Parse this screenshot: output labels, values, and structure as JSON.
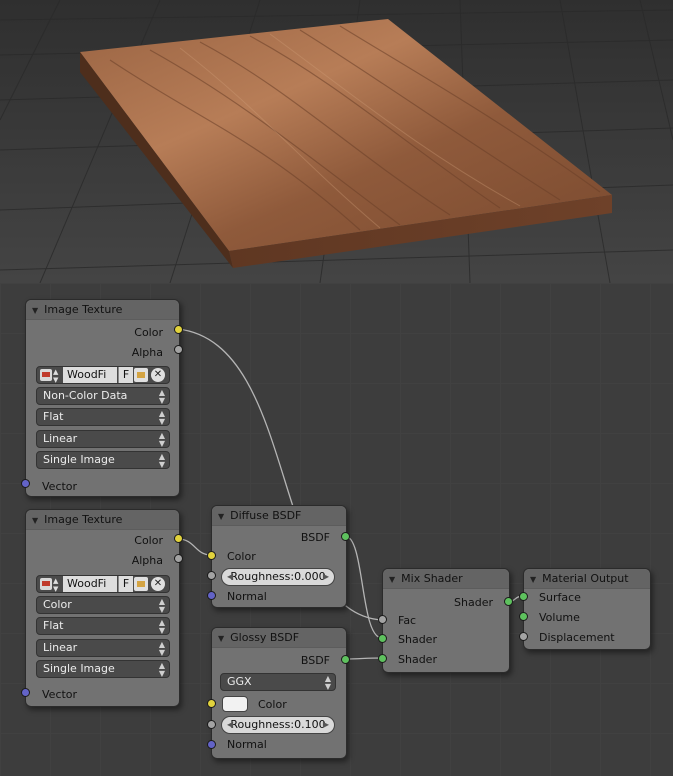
{
  "viewport": {
    "board_color": "#8a5638"
  },
  "nodes": {
    "image_texture_1": {
      "title": "Image Texture",
      "outputs": {
        "color": "Color",
        "alpha": "Alpha"
      },
      "image_name": "WoodFi",
      "fake_user": "F",
      "color_space": "Non-Color Data",
      "projection": "Flat",
      "interpolation": "Linear",
      "extension": "Single Image",
      "input_vector": "Vector"
    },
    "image_texture_2": {
      "title": "Image Texture",
      "outputs": {
        "color": "Color",
        "alpha": "Alpha"
      },
      "image_name": "WoodFi",
      "fake_user": "F",
      "color_space": "Color",
      "projection": "Flat",
      "interpolation": "Linear",
      "extension": "Single Image",
      "input_vector": "Vector"
    },
    "diffuse_bsdf": {
      "title": "Diffuse BSDF",
      "output_bsdf": "BSDF",
      "input_color": "Color",
      "roughness": "Roughness:0.000",
      "input_normal": "Normal"
    },
    "glossy_bsdf": {
      "title": "Glossy BSDF",
      "output_bsdf": "BSDF",
      "distribution": "GGX",
      "input_color": "Color",
      "roughness": "Roughness:0.100",
      "input_normal": "Normal"
    },
    "mix_shader": {
      "title": "Mix Shader",
      "output_shader": "Shader",
      "input_fac": "Fac",
      "input_shader_1": "Shader",
      "input_shader_2": "Shader"
    },
    "material_output": {
      "title": "Material Output",
      "input_surface": "Surface",
      "input_volume": "Volume",
      "input_displacement": "Displacement"
    }
  },
  "socket_colors": {
    "color": "#e2d33d",
    "float": "#a3a3a3",
    "vector": "#6363c7",
    "shader": "#5ec15e"
  }
}
